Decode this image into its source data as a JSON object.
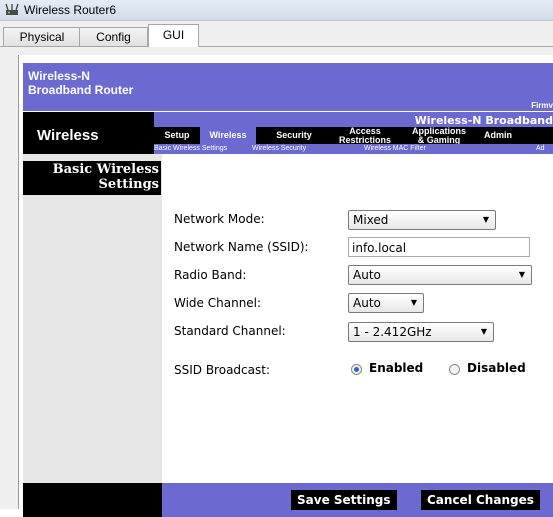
{
  "window": {
    "title": "Wireless Router6"
  },
  "tabs": [
    {
      "label": "Physical"
    },
    {
      "label": "Config"
    },
    {
      "label": "GUI"
    }
  ],
  "header": {
    "brand_line1": "Wireless-N",
    "brand_line2": "Broadband Router",
    "firmware": "Firmv",
    "product": "Wireless-N Broadband"
  },
  "nav": {
    "title": "Wireless",
    "menu": {
      "setup": "Setup",
      "wireless": "Wireless",
      "security": "Security",
      "access_l1": "Access",
      "access_l2": "Restrictions",
      "apps_l1": "Applications",
      "apps_l2": "& Gaming",
      "admin": "Admin"
    },
    "submenu": {
      "basic": "Basic Wireless Settings",
      "security": "Wireless Security",
      "mac": "Wireless MAC Filter",
      "adv": "Ad"
    }
  },
  "section": {
    "title_line1": "Basic Wireless",
    "title_line2": "Settings"
  },
  "form": {
    "network_mode_label": "Network Mode:",
    "network_mode_value": "Mixed",
    "ssid_label": "Network Name (SSID):",
    "ssid_value": "info.local",
    "radio_band_label": "Radio Band:",
    "radio_band_value": "Auto",
    "wide_channel_label": "Wide Channel:",
    "wide_channel_value": "Auto",
    "standard_channel_label": "Standard Channel:",
    "standard_channel_value": "1 - 2.412GHz",
    "ssid_broadcast_label": "SSID Broadcast:",
    "ssid_broadcast_enabled": "Enabled",
    "ssid_broadcast_disabled": "Disabled",
    "ssid_broadcast_selected": "Enabled"
  },
  "buttons": {
    "save": "Save Settings",
    "cancel": "Cancel Changes"
  },
  "colors": {
    "purple": "#6c69d0",
    "black": "#000000",
    "sidebar": "#e7e7e7",
    "radio_selected": "#2c64c9"
  },
  "icons": {
    "app": "router-icon",
    "dropdown": "chevron-down-icon"
  }
}
